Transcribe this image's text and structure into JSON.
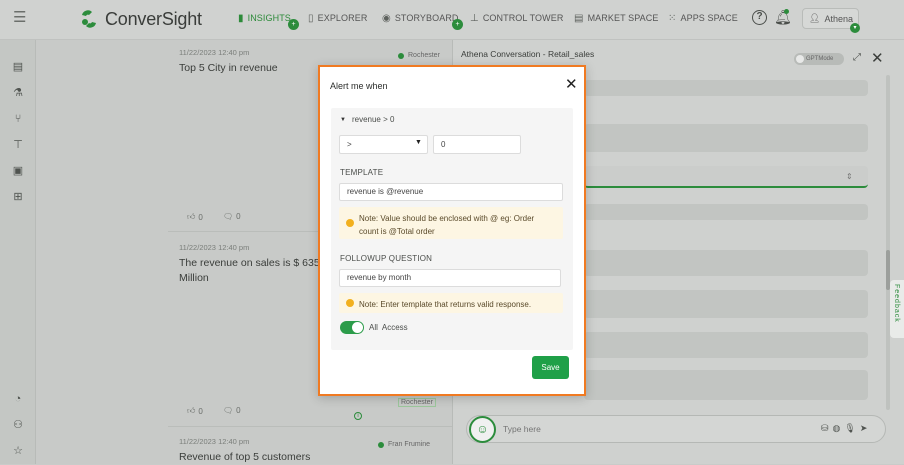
{
  "app": {
    "logo_text": "ConverSight"
  },
  "nav": [
    {
      "label": "INSIGHTS",
      "badge": "+"
    },
    {
      "label": "EXPLORER"
    },
    {
      "label": "STORYBOARD",
      "badge": "+"
    },
    {
      "label": "CONTROL TOWER"
    },
    {
      "label": "MARKET SPACE"
    },
    {
      "label": "APPS SPACE"
    }
  ],
  "user": {
    "name": "Athena"
  },
  "feed": {
    "cards": [
      {
        "timestamp": "11/22/2023 12:40 pm",
        "title": "Top 5 City in revenue",
        "location": "Rochester",
        "likes": "0",
        "comments": "0"
      },
      {
        "timestamp": "11/22/2023 12:40 pm",
        "title": "The revenue on sales is $ 635",
        "title2": "Million",
        "location": "Rochester",
        "likes": "0",
        "comments": "0"
      },
      {
        "timestamp": "11/22/2023 12:40 pm",
        "title": "Revenue of top 5 customers",
        "location": "Fran Frumine"
      }
    ]
  },
  "conversation": {
    "title": "Athena Conversation - Retail_sales",
    "gpt_mode_label": "GPTMode",
    "input_placeholder": "Type here",
    "feedback_label": "Feedback"
  },
  "modal": {
    "title": "Alert me when",
    "condition_summary": "revenue > 0",
    "operator": ">",
    "value": "0",
    "template_label": "TEMPLATE",
    "template_value": "revenue is @revenue",
    "template_note": "Note: Value should be enclosed with @ eg: Order count is @Total order",
    "followup_label": "FOLLOWUP QUESTION",
    "followup_value": "revenue by month",
    "followup_note": "Note: Enter template that returns valid response.",
    "access_label": "All  Access",
    "save_label": "Save"
  }
}
